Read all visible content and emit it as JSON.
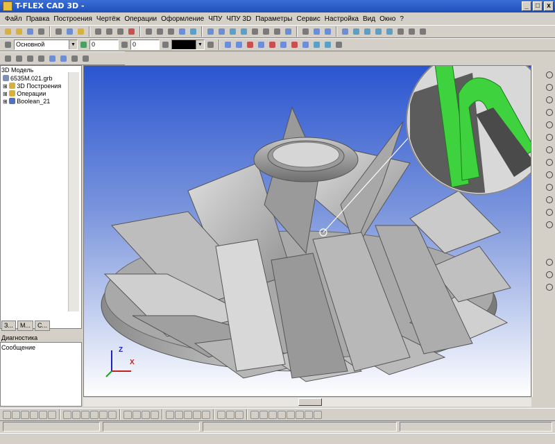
{
  "window": {
    "title": "T-FLEX CAD 3D -",
    "minimize": "_",
    "maximize": "□",
    "close": "x"
  },
  "menu": [
    "Файл",
    "Правка",
    "Построения",
    "Чертёж",
    "Операции",
    "Оформление",
    "ЧПУ",
    "ЧПУ 3D",
    "Параметры",
    "Сервис",
    "Настройка",
    "Вид",
    "Окно",
    "?"
  ],
  "toolbar2": {
    "layer_value": "Основной",
    "field1_value": "0",
    "field2_value": "0"
  },
  "left_panel": {
    "title": "3D Модель",
    "tree": [
      {
        "label": "6535М.021.grb",
        "icon": "file-icon"
      },
      {
        "label": "3D Построения",
        "icon": "folder-icon"
      },
      {
        "label": "Операции",
        "icon": "folder-icon"
      },
      {
        "label": "Boolean_21",
        "icon": "solid-icon"
      }
    ],
    "tabs": [
      "З...",
      "М...",
      "С..."
    ]
  },
  "diagnostics": {
    "title": "Диагностика",
    "column": "Сообщение"
  },
  "axis": {
    "z": "Z",
    "x": "X"
  },
  "colors": {
    "viewport_top": "#2a55d0",
    "viewport_bottom": "#ffffff",
    "detail_green": "#3fd23f",
    "titlebar": "#2a5ec8"
  }
}
